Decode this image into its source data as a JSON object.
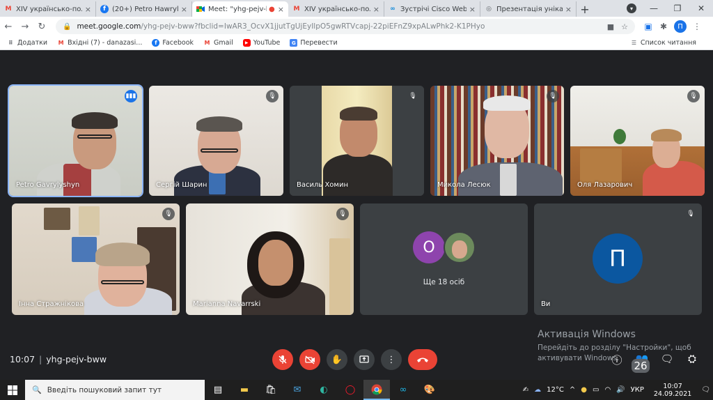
{
  "browser": {
    "tabs": [
      {
        "title": "XIV українсько-польс",
        "icon": "gmail-icon",
        "active": false
      },
      {
        "title": "(20+) Petro Hawrylysh",
        "icon": "facebook-icon",
        "active": false
      },
      {
        "title": "Meet: \"yhg-pejv-b",
        "icon": "meet-icon",
        "active": true
      },
      {
        "title": "XIV українсько-польс",
        "icon": "gmail-icon",
        "active": false
      },
      {
        "title": "Зустрічі Cisco Webex",
        "icon": "webex-icon",
        "active": false
      },
      {
        "title": "Презентація унікальн",
        "icon": "globe-icon",
        "active": false
      }
    ],
    "url_host": "meet.google.com",
    "url_rest": "/yhg-pejv-bww?fbclid=IwAR3_OcvX1jjutTgUjEyIlpO5gwRTVcapj-22piEFnZ9xpALwPhk2-K1PHyo",
    "profile_initial": "П",
    "bookmarks": [
      {
        "label": "Додатки",
        "icon": "apps-icon"
      },
      {
        "label": "Вхідні (7) - danazasi...",
        "icon": "gmail-icon"
      },
      {
        "label": "Facebook",
        "icon": "facebook-icon"
      },
      {
        "label": "Gmail",
        "icon": "gmail-icon"
      },
      {
        "label": "YouTube",
        "icon": "youtube-icon"
      },
      {
        "label": "Перевести",
        "icon": "translate-icon"
      }
    ],
    "reading_list": "Список читання"
  },
  "meet": {
    "participants": [
      {
        "name": "Petro Gavrylyshyn",
        "speaking": true,
        "muted": false
      },
      {
        "name": "Сергій Шарин",
        "speaking": false,
        "muted": true
      },
      {
        "name": "Василь Хомин",
        "speaking": false,
        "muted": true
      },
      {
        "name": "Микола Лесюк",
        "speaking": false,
        "muted": true
      },
      {
        "name": "Оля Лазарович",
        "speaking": false,
        "muted": true
      },
      {
        "name": "Інна Стражнікова",
        "speaking": false,
        "muted": true
      },
      {
        "name": "Marianna Navarrski",
        "speaking": false,
        "muted": true
      }
    ],
    "more_tile": {
      "label": "Ще 18 осіб",
      "initial": "О",
      "color": "#8e44ad"
    },
    "self_tile": {
      "name": "Ви",
      "initial": "П",
      "color": "#0b57a0"
    },
    "time": "10:07",
    "meeting_code": "yhg-pejv-bww",
    "people_count": "26"
  },
  "activation": {
    "title": "Активація Windows",
    "line1": "Перейдіть до розділу \"Настройки\", щоб",
    "line2": "активувати Windows."
  },
  "taskbar": {
    "search_placeholder": "Введіть пошуковий запит тут",
    "temperature": "12°C",
    "language": "УКР",
    "time": "10:07",
    "date": "24.09.2021"
  }
}
